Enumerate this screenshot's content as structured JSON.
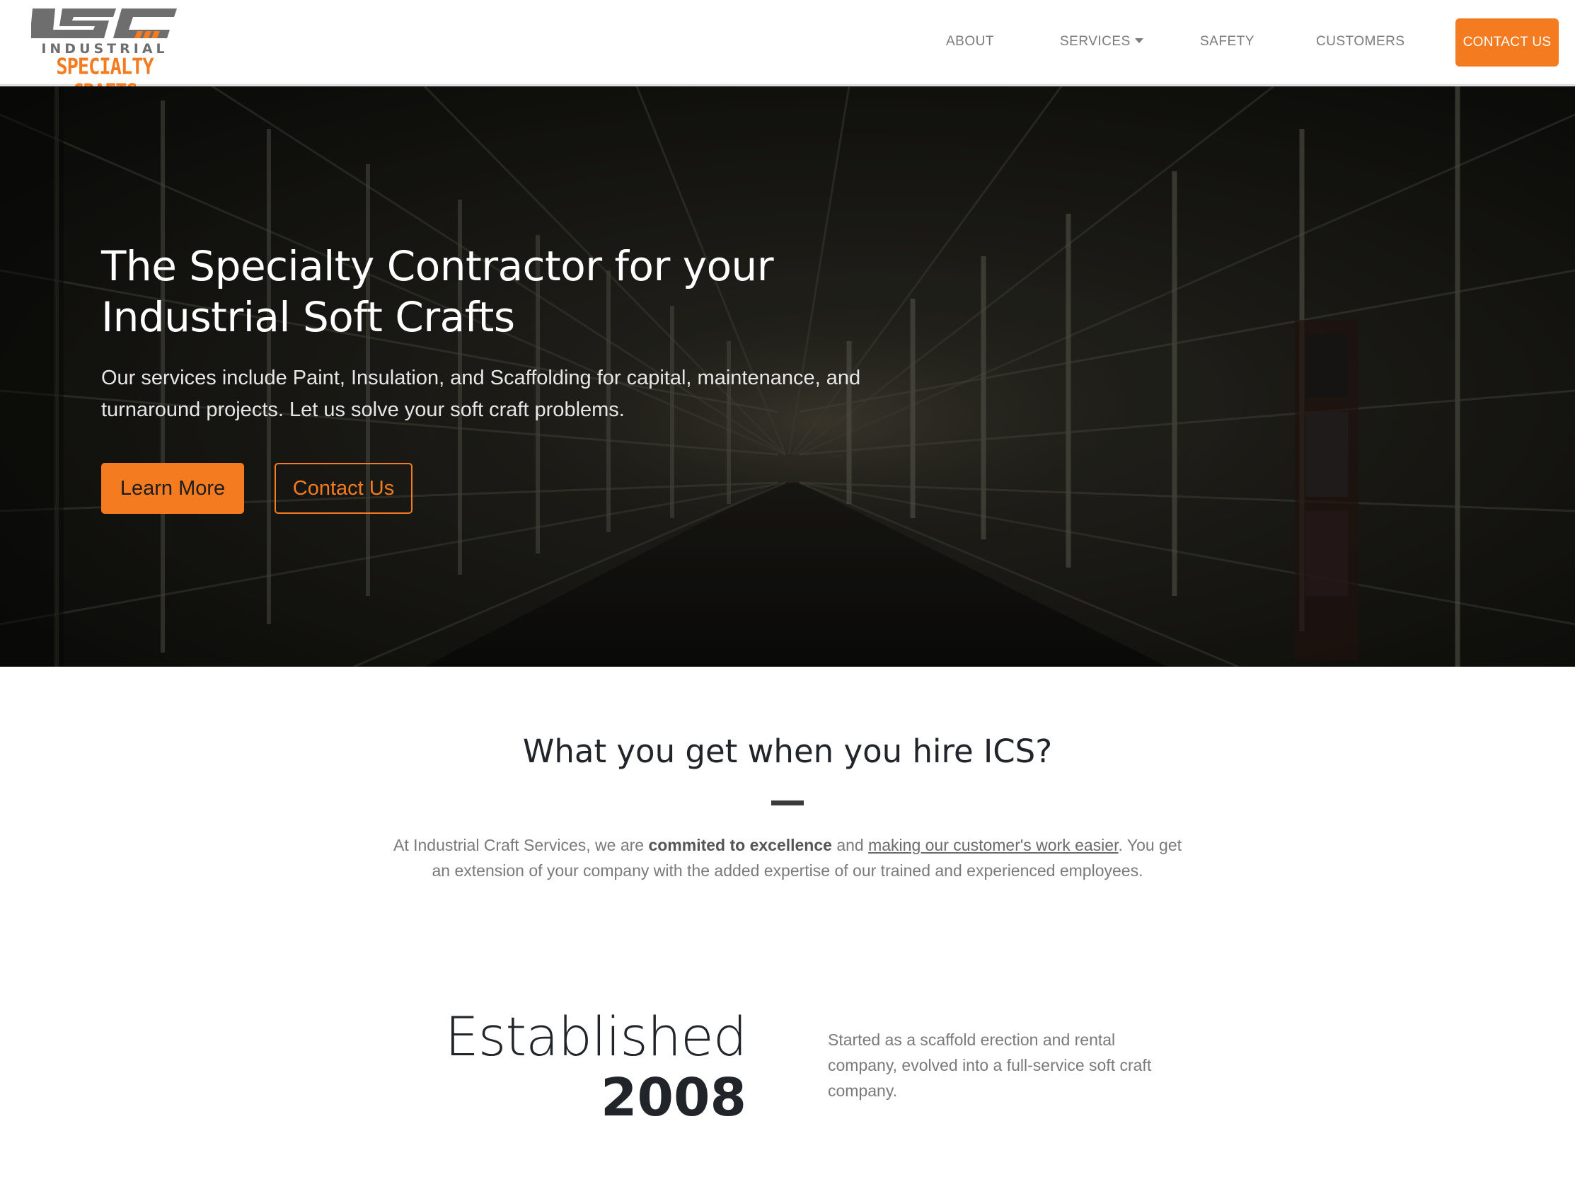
{
  "brand": {
    "logo_mark": "ISC",
    "logo_line1": "INDUSTRIAL",
    "logo_line2": "SPECIALTY CRAFTS",
    "accent": "#f47b20",
    "gray": "#6e6e6e"
  },
  "nav": {
    "about": "ABOUT",
    "services": "SERVICES",
    "safety": "SAFETY",
    "customers": "CUSTOMERS",
    "cta": "CONTACT US"
  },
  "hero": {
    "title_line1": "The Specialty Contractor for your",
    "title_line2": "Industrial Soft Crafts",
    "subtitle": "Our services include Paint, Insulation, and Scaffolding for capital, maintenance, and turnaround projects. Let us solve your soft craft problems.",
    "learn_more": "Learn More",
    "contact_us": "Contact Us"
  },
  "about": {
    "heading": "What you get when you hire ICS?",
    "intro_part1": "At Industrial Craft Services, we are ",
    "intro_bold": "commited to excellence",
    "intro_part2": " and ",
    "intro_link": "making our customer's work easier",
    "intro_part3": ". You get an extension of your company with the added expertise of our trained and experienced employees."
  },
  "established": {
    "label": "Established",
    "year": "2008",
    "description": "Started as a scaffold erection and rental company, evolved into a full-service soft craft company."
  }
}
